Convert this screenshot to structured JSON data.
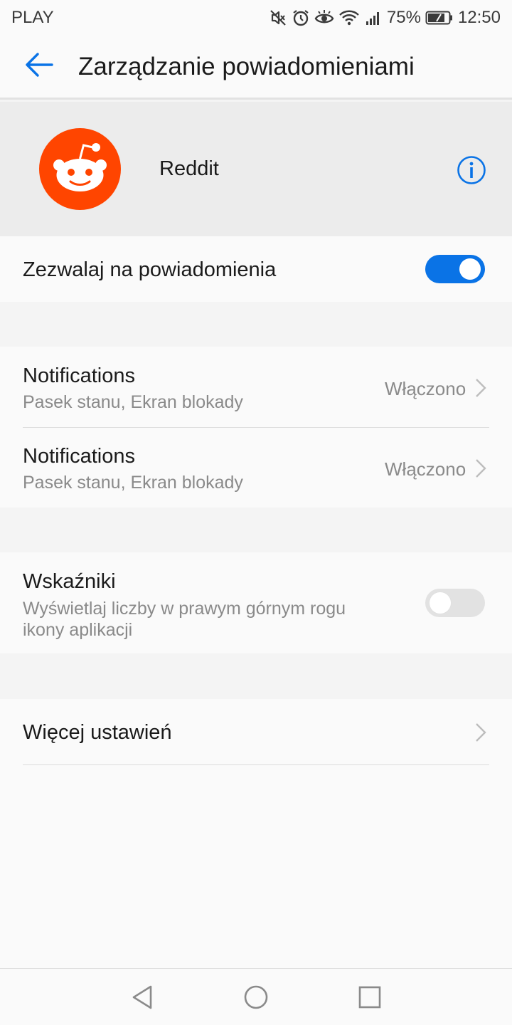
{
  "status_bar": {
    "carrier": "PLAY",
    "battery_percent": "75%",
    "time": "12:50",
    "icons": [
      "mute-icon",
      "alarm-icon",
      "eye-comfort-icon",
      "wifi-icon",
      "signal-icon",
      "battery-icon"
    ]
  },
  "header": {
    "title": "Zarządzanie powiadomieniami",
    "back_icon": "arrow-left-icon",
    "accent_color": "#0a73e6"
  },
  "app": {
    "name": "Reddit",
    "logo_color": "#ff4500",
    "info_icon": "info-circle-icon"
  },
  "allow_notifications": {
    "label": "Zezwalaj na powiadomienia",
    "enabled": true
  },
  "channels": [
    {
      "title": "Notifications",
      "subtitle": "Pasek stanu, Ekran blokady",
      "value": "Włączono"
    },
    {
      "title": "Notifications",
      "subtitle": "Pasek stanu, Ekran blokady",
      "value": "Włączono"
    }
  ],
  "badges": {
    "title": "Wskaźniki",
    "subtitle_line1": "Wyświetlaj liczby w prawym górnym rogu",
    "subtitle_line2": "ikony aplikacji",
    "enabled": false
  },
  "more_settings": {
    "label": "Więcej ustawień"
  },
  "nav_bar": {
    "icons": [
      "nav-back-icon",
      "nav-home-icon",
      "nav-recents-icon"
    ]
  }
}
